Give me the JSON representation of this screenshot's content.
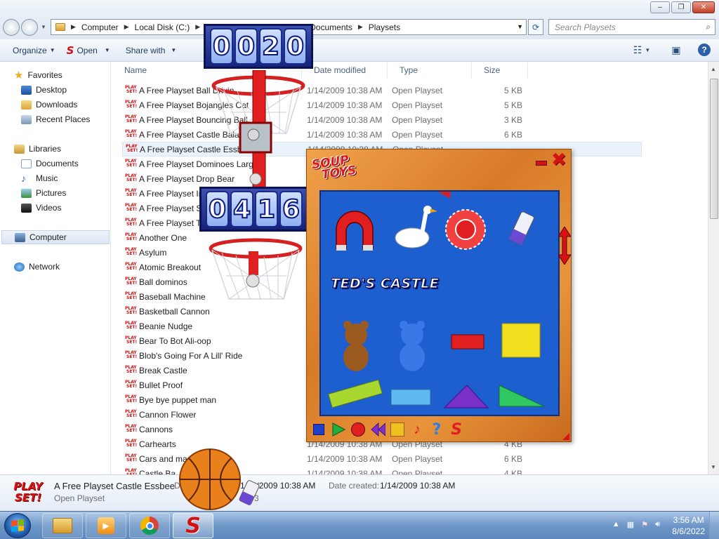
{
  "window": {
    "controls": {
      "minimize": "–",
      "maximize": "❐",
      "close": "✕"
    }
  },
  "address_bar": {
    "crumbs": [
      "Computer",
      "Local Disk (C:)",
      "",
      "Documents",
      "Playsets"
    ],
    "search_placeholder": "Search Playsets"
  },
  "toolbar": {
    "organize": "Organize",
    "open": "Open",
    "share_with": "Share with"
  },
  "nav": {
    "favorites": "Favorites",
    "desktop": "Desktop",
    "downloads": "Downloads",
    "recent_places": "Recent Places",
    "libraries": "Libraries",
    "documents": "Documents",
    "music": "Music",
    "pictures": "Pictures",
    "videos": "Videos",
    "computer": "Computer",
    "network": "Network"
  },
  "columns": {
    "name": "Name",
    "date": "Date modified",
    "type": "Type",
    "size": "Size"
  },
  "files": [
    {
      "name": "A Free Playset Ball Drivin",
      "date": "1/14/2009 10:38 AM",
      "type": "Open Playset",
      "size": "5 KB"
    },
    {
      "name": "A Free Playset Bojangles Cat",
      "date": "1/14/2009 10:38 AM",
      "type": "Open Playset",
      "size": "5 KB"
    },
    {
      "name": "A Free Playset Bouncing Ball",
      "date": "1/14/2009 10:38 AM",
      "type": "Open Playset",
      "size": "3 KB"
    },
    {
      "name": "A Free Playset Castle Balance",
      "date": "1/14/2009 10:38 AM",
      "type": "Open Playset",
      "size": "6 KB"
    },
    {
      "name": "A Free Playset Castle Essbee",
      "date": "1/14/2009 10:38 AM",
      "type": "Open Playset",
      "size": ""
    },
    {
      "name": "A Free Playset Dominoes Large",
      "date": "",
      "type": "",
      "size": ""
    },
    {
      "name": "A Free Playset Drop Bear",
      "date": "",
      "type": "",
      "size": ""
    },
    {
      "name": "A Free Playset Im",
      "date": "",
      "type": "",
      "size": ""
    },
    {
      "name": "A Free Playset Sk",
      "date": "",
      "type": "",
      "size": ""
    },
    {
      "name": "A Free Playset Te",
      "date": "",
      "type": "",
      "size": ""
    },
    {
      "name": "Another One",
      "date": "",
      "type": "",
      "size": ""
    },
    {
      "name": "Asylum",
      "date": "",
      "type": "",
      "size": ""
    },
    {
      "name": "Atomic Breakout",
      "date": "",
      "type": "",
      "size": ""
    },
    {
      "name": "Ball dominos",
      "date": "",
      "type": "",
      "size": ""
    },
    {
      "name": "Baseball Machine",
      "date": "",
      "type": "",
      "size": ""
    },
    {
      "name": "Basketball Cannon",
      "date": "",
      "type": "",
      "size": ""
    },
    {
      "name": "Beanie Nudge",
      "date": "",
      "type": "",
      "size": ""
    },
    {
      "name": "Bear To Bot Ali-oop",
      "date": "",
      "type": "",
      "size": ""
    },
    {
      "name": "Blob's Going For A Lill' Ride",
      "date": "",
      "type": "",
      "size": ""
    },
    {
      "name": "Break Castle",
      "date": "",
      "type": "",
      "size": ""
    },
    {
      "name": "Bullet Proof",
      "date": "",
      "type": "",
      "size": ""
    },
    {
      "name": "Bye bye puppet man",
      "date": "",
      "type": "",
      "size": ""
    },
    {
      "name": "Cannon Flower",
      "date": "",
      "type": "",
      "size": ""
    },
    {
      "name": "Cannons",
      "date": "",
      "type": "",
      "size": ""
    },
    {
      "name": "Carhearts",
      "date": "1/14/2009 10:38 AM",
      "type": "Open Playset",
      "size": "4 KB"
    },
    {
      "name": "Cars and ma",
      "date": "1/14/2009 10:38 AM",
      "type": "Open Playset",
      "size": "6 KB"
    },
    {
      "name": "Castle Ba",
      "date": "1/14/2009 10:38 AM",
      "type": "Open Playset",
      "size": "4 KB"
    }
  ],
  "file_icon_text": [
    "PLAY",
    "SET!"
  ],
  "details": {
    "logo_text": [
      "PLAY",
      "SET!"
    ],
    "name": "A Free Playset Castle Essbee",
    "type": "Open Playset",
    "modified_label": "D",
    "modified_value": "1/14/2009 10:38 AM",
    "created_label": "Date created:",
    "created_value": "1/14/2009 10:38 AM",
    "size_fragment": "3"
  },
  "game": {
    "score_top": [
      "0",
      "0",
      "2",
      "0"
    ],
    "score_bottom": [
      "0",
      "4",
      "1",
      "6"
    ],
    "logo": [
      "SOUP",
      "TOYS"
    ],
    "palette_label": "TED'S CASTLE",
    "minimize": "",
    "close": "✖"
  },
  "taskbar": {
    "time": "3:56 AM",
    "date": "8/6/2022",
    "tray_expand": "▲"
  },
  "colors": {
    "playset_red": "#d41010",
    "palette_blue": "#1e5fd0",
    "game_orange": "#e8943a"
  }
}
